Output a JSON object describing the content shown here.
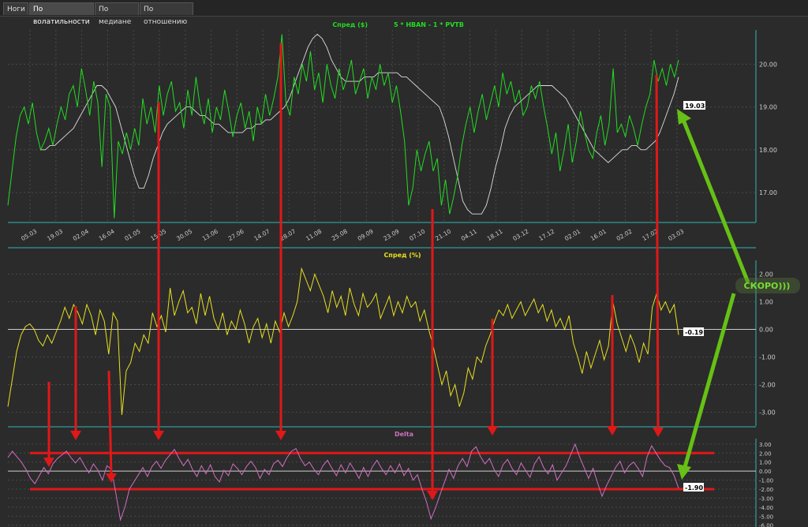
{
  "tabs": [
    {
      "label": "Ноги",
      "active": false
    },
    {
      "label": "По волатильности",
      "active": true
    },
    {
      "label": "По медиане",
      "active": false
    },
    {
      "label": "По отношению",
      "active": false
    }
  ],
  "colors": {
    "background": "#2b2b2b",
    "grid": "#555555",
    "axis": "#2fb5b5",
    "spread_line": "#22dd22",
    "ma_line": "#dddddd",
    "pct_line": "#e8e020",
    "delta_line": "#d070c0",
    "arrow_red": "#e01818",
    "arrow_green": "#66c016",
    "band_red": "#e01818"
  },
  "annotation": {
    "text": "СКОРО)))"
  },
  "chart_data": [
    {
      "type": "line",
      "title": "Спред ($)",
      "subtitle": "5 * HBAN - 1 * PVTB",
      "ylim": [
        16.3,
        20.8
      ],
      "yticks": [
        "20.00",
        "19.00",
        "18.00",
        "17.00"
      ],
      "ytick_values": [
        20,
        19,
        18,
        17
      ],
      "xticks": [
        "05.03",
        "19.03",
        "02.04",
        "16.04",
        "01.05",
        "15.05",
        "30.05",
        "13.06",
        "27.06",
        "14.07",
        "28.07",
        "11.08",
        "25.08",
        "09.09",
        "23.09",
        "07.10",
        "21.10",
        "04.11",
        "18.11",
        "03.12",
        "17.12",
        "02.01",
        "16.01",
        "02.02",
        "17.02",
        "03.03"
      ],
      "last_value_label": "19.03",
      "series": [
        {
          "values": [
            16.7,
            17.5,
            18.3,
            18.8,
            19.0,
            18.6,
            19.1,
            18.4,
            18.0,
            18.2,
            18.5,
            18.1,
            18.6,
            19.0,
            18.7,
            19.3,
            19.5,
            19.0,
            19.9,
            19.4,
            18.8,
            19.6,
            19.1,
            17.6,
            19.3,
            19.0,
            16.4,
            18.2,
            17.9,
            18.4,
            18.0,
            18.5,
            18.1,
            19.2,
            18.6,
            19.0,
            18.4,
            19.5,
            18.8,
            19.3,
            19.6,
            18.9,
            19.1,
            18.5,
            19.4,
            18.8,
            19.7,
            19.0,
            18.6,
            19.2,
            18.4,
            19.0,
            18.7,
            19.4,
            18.9,
            18.3,
            18.8,
            19.1,
            18.5,
            18.9,
            18.2,
            19.0,
            18.6,
            19.3,
            18.8,
            19.2,
            19.7,
            20.7,
            19.1,
            18.8,
            19.7,
            19.3,
            20.0,
            19.6,
            20.3,
            19.4,
            19.8,
            19.1,
            20.0,
            19.5,
            19.2,
            19.9,
            19.4,
            19.7,
            20.1,
            19.3,
            19.6,
            19.9,
            19.2,
            19.7,
            19.4,
            20.0,
            19.5,
            19.8,
            19.1,
            19.5,
            18.9,
            18.2,
            16.7,
            17.1,
            18.0,
            17.5,
            17.9,
            18.2,
            17.5,
            17.8,
            16.7,
            17.3,
            16.5,
            16.9,
            17.4,
            18.1,
            18.6,
            19.0,
            18.4,
            18.9,
            19.3,
            18.7,
            19.1,
            19.5,
            19.0,
            19.8,
            19.3,
            19.6,
            19.1,
            19.4,
            18.8,
            19.0,
            19.5,
            19.2,
            19.6,
            19.0,
            18.5,
            17.9,
            18.4,
            17.5,
            18.0,
            18.6,
            17.7,
            18.2,
            18.9,
            18.4,
            18.0,
            17.8,
            18.4,
            18.8,
            18.1,
            18.6,
            19.9,
            18.4,
            18.6,
            18.3,
            18.8,
            18.5,
            18.1,
            18.6,
            19.0,
            19.3,
            20.1,
            19.6,
            19.9,
            19.5,
            20.0,
            19.7,
            20.1
          ]
        },
        {
          "values": [
            18.0,
            18.0,
            18.1,
            18.1,
            18.2,
            18.3,
            18.4,
            18.5,
            18.7,
            18.9,
            19.1,
            19.3,
            19.5,
            19.5,
            19.4,
            19.2,
            19.0,
            18.6,
            18.2,
            17.8,
            17.4,
            17.1,
            17.1,
            17.4,
            17.8,
            18.1,
            18.4,
            18.6,
            18.7,
            18.8,
            18.9,
            19.0,
            19.0,
            18.9,
            18.8,
            18.8,
            18.7,
            18.6,
            18.6,
            18.5,
            18.4,
            18.4,
            18.4,
            18.4,
            18.5,
            18.5,
            18.6,
            18.6,
            18.7,
            18.7,
            18.8,
            18.9,
            19.0,
            19.2,
            19.5,
            19.8,
            20.1,
            20.4,
            20.6,
            20.7,
            20.6,
            20.4,
            20.1,
            19.9,
            19.7,
            19.6,
            19.6,
            19.6,
            19.6,
            19.7,
            19.7,
            19.7,
            19.8,
            19.8,
            19.8,
            19.8,
            19.8,
            19.7,
            19.7,
            19.6,
            19.5,
            19.4,
            19.3,
            19.2,
            19.1,
            19.0,
            18.7,
            18.3,
            17.8,
            17.3,
            16.8,
            16.6,
            16.5,
            16.5,
            16.5,
            16.7,
            17.1,
            17.6,
            18.0,
            18.5,
            18.8,
            19.0,
            19.1,
            19.2,
            19.3,
            19.4,
            19.5,
            19.5,
            19.5,
            19.5,
            19.4,
            19.3,
            19.2,
            19.0,
            18.8,
            18.6,
            18.4,
            18.2,
            18.0,
            17.9,
            17.8,
            17.7,
            17.8,
            17.9,
            18.0,
            18.0,
            18.1,
            18.1,
            18.0,
            18.0,
            18.1,
            18.2,
            18.4,
            18.7,
            19.0,
            19.3,
            19.7
          ]
        }
      ]
    },
    {
      "type": "line",
      "title": "Спред (%)",
      "ylim": [
        -3.5,
        2.5
      ],
      "yticks": [
        "2.00",
        "1.00",
        "0.00",
        "-1.00",
        "-2.00",
        "-3.00"
      ],
      "ytick_values": [
        2,
        1,
        0,
        -1,
        -2,
        -3
      ],
      "last_value_label": "-0.19",
      "series": [
        {
          "values": [
            -2.8,
            -1.8,
            -0.8,
            -0.2,
            0.1,
            0.2,
            0.0,
            -0.4,
            -0.6,
            -0.2,
            -0.5,
            -0.1,
            0.3,
            0.8,
            0.4,
            0.9,
            0.6,
            0.2,
            0.9,
            0.5,
            -0.2,
            0.7,
            0.3,
            -0.9,
            0.6,
            0.3,
            -3.1,
            -1.5,
            -1.2,
            -0.5,
            -0.8,
            -0.2,
            -0.5,
            0.6,
            0.1,
            0.5,
            -0.1,
            1.5,
            0.5,
            1.0,
            1.4,
            0.6,
            0.8,
            0.2,
            1.3,
            0.5,
            1.2,
            0.4,
            0.0,
            0.6,
            -0.2,
            0.3,
            0.0,
            0.7,
            0.2,
            -0.5,
            0.1,
            0.4,
            -0.3,
            0.2,
            -0.5,
            0.3,
            -0.1,
            0.6,
            0.1,
            0.5,
            1.0,
            2.2,
            1.8,
            1.4,
            2.0,
            1.6,
            1.2,
            0.6,
            1.4,
            0.8,
            1.2,
            0.5,
            1.5,
            0.9,
            0.5,
            1.3,
            0.8,
            1.0,
            1.3,
            0.4,
            0.8,
            1.2,
            0.5,
            1.0,
            0.6,
            1.2,
            0.8,
            1.0,
            0.3,
            0.7,
            0.0,
            -0.6,
            -1.3,
            -2.0,
            -1.5,
            -2.4,
            -2.0,
            -2.8,
            -2.3,
            -1.4,
            -1.8,
            -1.0,
            -1.2,
            -0.6,
            -0.2,
            0.3,
            0.7,
            0.5,
            0.9,
            0.4,
            0.7,
            1.0,
            0.5,
            0.8,
            1.1,
            0.6,
            0.9,
            0.3,
            0.7,
            0.1,
            0.4,
            0.0,
            0.5,
            -0.5,
            -1.0,
            -1.6,
            -0.8,
            -1.4,
            -0.9,
            -0.4,
            -1.1,
            -0.6,
            1.0,
            0.2,
            -0.3,
            -0.8,
            -0.2,
            -0.6,
            -1.2,
            -0.5,
            -0.9,
            0.8,
            1.3,
            0.7,
            1.0,
            0.6,
            0.9,
            -0.2
          ]
        }
      ]
    },
    {
      "type": "line",
      "title": "Delta",
      "ylim": [
        -6.2,
        3.6
      ],
      "yticks": [
        "3.00",
        "2.00",
        "1.00",
        "0.00",
        "-1.00",
        "-2.00",
        "-3.00",
        "-4.00",
        "-5.00",
        "-6.00"
      ],
      "ytick_values": [
        3,
        2,
        1,
        0,
        -1,
        -2,
        -3,
        -4,
        -5,
        -6
      ],
      "bands": [
        2.0,
        -2.0
      ],
      "last_value_label": "-1.90",
      "series": [
        {
          "values": [
            1.5,
            2.2,
            1.6,
            1.0,
            0.2,
            -0.8,
            -1.4,
            -0.5,
            0.4,
            -0.3,
            0.8,
            1.4,
            1.8,
            2.2,
            1.5,
            0.9,
            1.5,
            0.6,
            -0.2,
            0.8,
            0.1,
            -1.0,
            0.6,
            0.2,
            -2.5,
            -5.4,
            -4.0,
            -2.0,
            -1.2,
            -0.4,
            0.4,
            -0.6,
            0.5,
            1.1,
            0.3,
            1.2,
            1.8,
            2.4,
            1.4,
            0.6,
            1.3,
            0.2,
            -0.6,
            0.6,
            -0.3,
            0.7,
            -0.6,
            -1.2,
            0.1,
            -0.5,
            0.8,
            0.3,
            -0.4,
            0.5,
            1.1,
            0.4,
            -0.8,
            0.2,
            -0.4,
            0.8,
            1.2,
            0.5,
            1.5,
            2.2,
            2.5,
            1.4,
            0.6,
            1.0,
            0.2,
            -0.4,
            0.6,
            1.2,
            0.3,
            -0.5,
            0.7,
            -0.2,
            0.9,
            0.1,
            -0.8,
            0.4,
            -0.6,
            0.5,
            1.2,
            0.3,
            -0.4,
            0.6,
            -0.2,
            0.8,
            -0.5,
            0.3,
            -1.0,
            -0.4,
            -2.0,
            -3.4,
            -5.3,
            -4.1,
            -2.6,
            -1.2,
            0.2,
            -0.8,
            0.6,
            1.4,
            0.5,
            2.2,
            2.7,
            1.6,
            0.8,
            1.4,
            0.2,
            -0.6,
            0.7,
            1.3,
            0.3,
            -0.4,
            0.9,
            0.1,
            -0.7,
            0.8,
            1.6,
            0.4,
            -0.3,
            0.7,
            -1.0,
            -0.2,
            0.6,
            1.8,
            3.0,
            1.6,
            0.4,
            -0.8,
            0.3,
            -1.3,
            -2.8,
            -1.6,
            -0.6,
            0.4,
            1.1,
            -0.2,
            0.6,
            1.0,
            0.3,
            -0.6,
            1.6,
            2.8,
            2.0,
            1.2,
            0.6,
            0.4,
            -0.5,
            -1.9
          ]
        }
      ]
    }
  ]
}
